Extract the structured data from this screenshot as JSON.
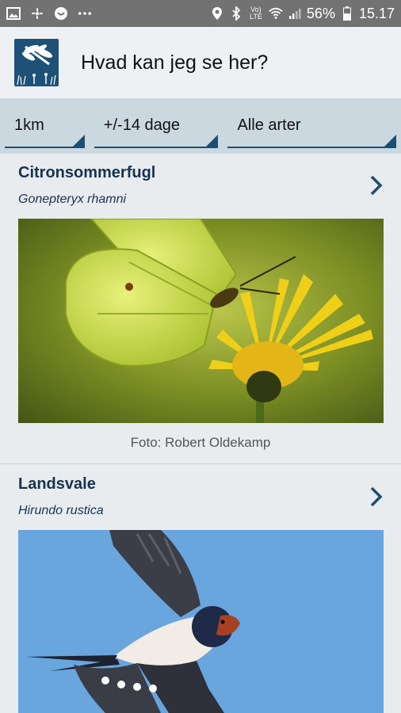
{
  "status_bar": {
    "battery": "56%",
    "time": "15.17",
    "icons": [
      "image-icon",
      "fan-icon",
      "circle-icon",
      "more-icon",
      "location-icon",
      "bluetooth-icon",
      "volte-icon",
      "wifi-icon",
      "signal-icon",
      "battery-icon"
    ]
  },
  "app": {
    "title": "Hvad kan jeg se her?"
  },
  "filters": [
    {
      "value": "1km"
    },
    {
      "value": "+/-14 dage"
    },
    {
      "value": "Alle arter"
    }
  ],
  "species": [
    {
      "name": "Citronsommerfugl",
      "latin": "Gonepteryx rhamni",
      "credit": "Foto: Robert Oldekamp",
      "photo": "butterfly-on-dandelion"
    },
    {
      "name": "Landsvale",
      "latin": "Hirundo rustica",
      "photo": "swallow-in-flight"
    }
  ],
  "colors": {
    "status_bar": "#727272",
    "app_bar": "#eef0f3",
    "filter_bar": "#cbd8df",
    "accent": "#1d4d70",
    "title_text": "#17334d",
    "logo_bg": "#1d5177"
  }
}
